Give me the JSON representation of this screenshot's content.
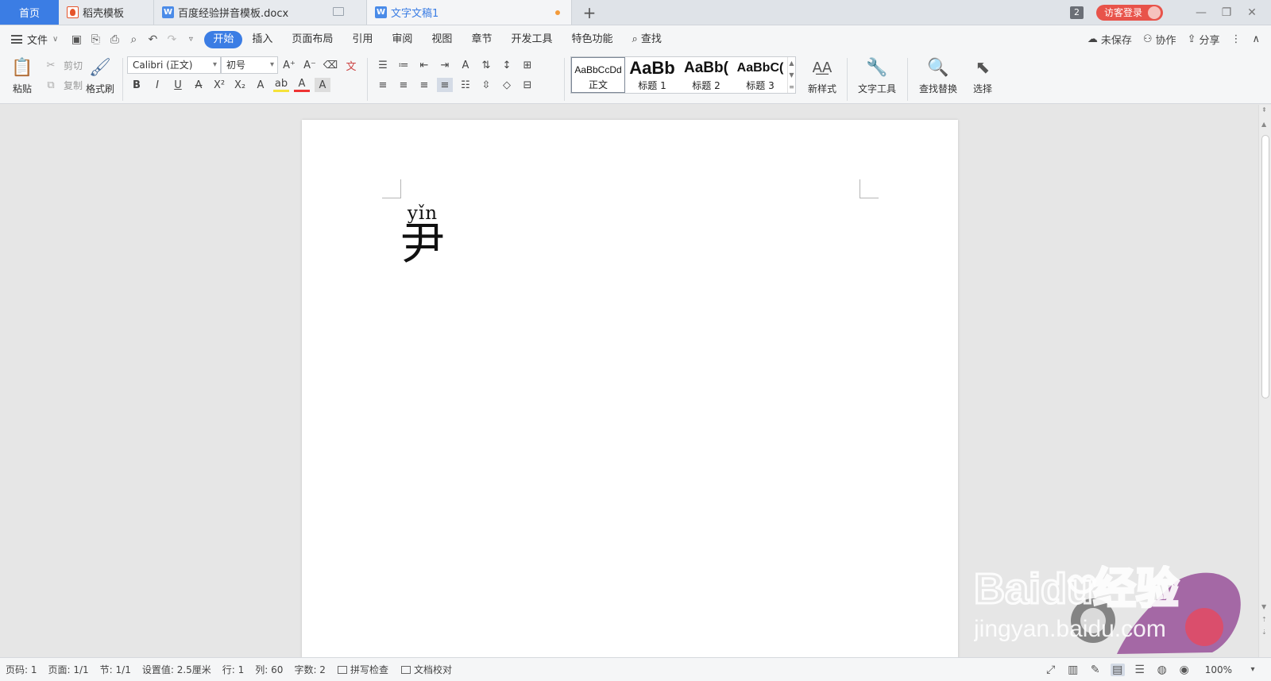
{
  "tabs": {
    "home": "首页",
    "items": [
      {
        "label": "稻壳模板",
        "icon": "wps-docer-icon"
      },
      {
        "label": "百度经验拼音模板.docx",
        "icon": "word-doc-icon"
      },
      {
        "label": "文字文稿1",
        "icon": "word-doc-icon"
      }
    ],
    "add": "+",
    "window_count": "2",
    "login": "访客登录"
  },
  "menu": {
    "file": "文件",
    "items": [
      "开始",
      "插入",
      "页面布局",
      "引用",
      "审阅",
      "视图",
      "章节",
      "开发工具",
      "特色功能"
    ],
    "search": "查找",
    "right": [
      "未保存",
      "协作",
      "分享"
    ]
  },
  "ribbon": {
    "paste": "粘贴",
    "cut": "剪切",
    "copy": "复制",
    "format_painter": "格式刷",
    "font_name": "Calibri (正文)",
    "font_size": "初号",
    "styles": [
      {
        "preview": "AaBbCcDd",
        "label": "正文"
      },
      {
        "preview": "AaBb",
        "label": "标题 1"
      },
      {
        "preview": "AaBb(",
        "label": "标题 2"
      },
      {
        "preview": "AaBbC(",
        "label": "标题 3"
      }
    ],
    "new_style": "新样式",
    "text_tools": "文字工具",
    "find_replace": "查找替换",
    "select": "选择"
  },
  "document": {
    "pinyin": "yǐn",
    "hanzi": "尹"
  },
  "status": {
    "page": "页码: 1",
    "pages": "页面: 1/1",
    "section": "节: 1/1",
    "setting": "设置值: 2.5厘米",
    "row": "行: 1",
    "col": "列: 60",
    "words": "字数: 2",
    "spell": "拼写检查",
    "proof": "文档校对",
    "zoom": "100%"
  },
  "watermark": {
    "brand": "Baidu经验",
    "url": "jingyan.baidu.com"
  },
  "colors": {
    "accent": "#3b7de4",
    "login": "#e8534a",
    "modified_dot": "#f39a3a"
  }
}
